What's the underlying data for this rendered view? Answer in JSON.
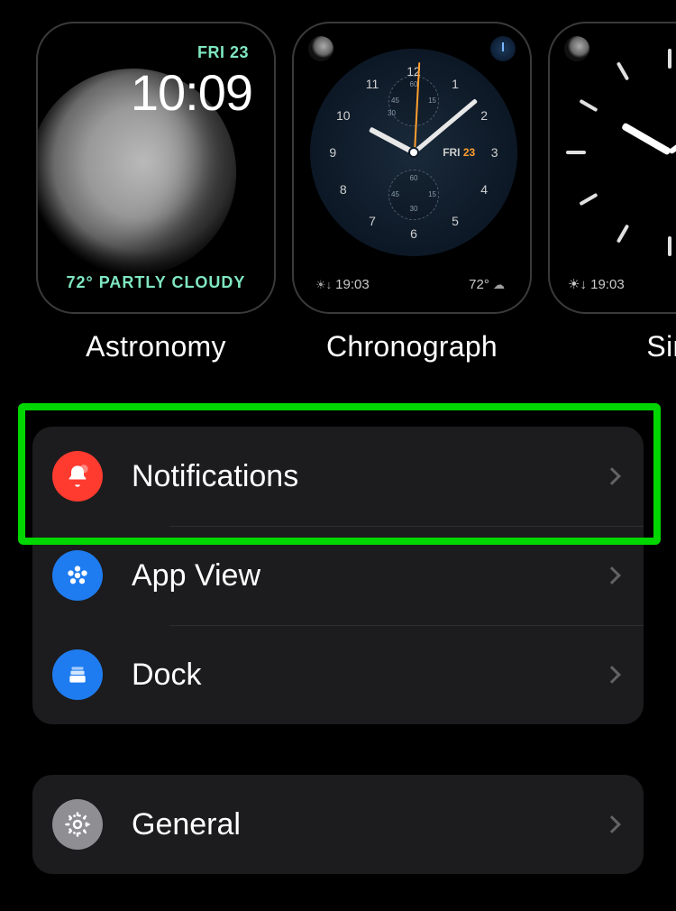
{
  "faces": {
    "astronomy": {
      "label": "Astronomy",
      "date": "FRI 23",
      "time": "10:09",
      "weather": "72° PARTLY CLOUDY"
    },
    "chronograph": {
      "label": "Chronograph",
      "day": "FRI",
      "daynum": "23",
      "sunset": "19:03",
      "temp": "72°",
      "sub_top": "60",
      "sub_bot_a": "15",
      "sub_bot_b": "45",
      "sub_bot_c": "30"
    },
    "simple": {
      "label": "Simple",
      "label_visible": "Sin",
      "sunset": "19:03"
    }
  },
  "settings": {
    "notifications": "Notifications",
    "app_view": "App View",
    "dock": "Dock",
    "general": "General"
  }
}
